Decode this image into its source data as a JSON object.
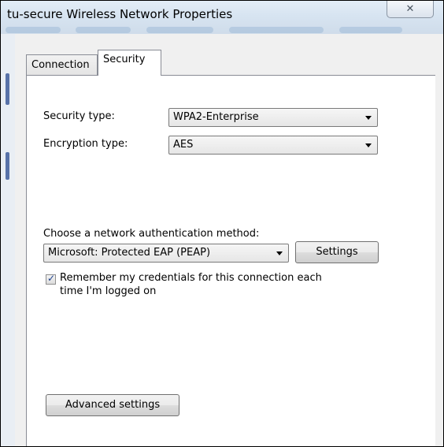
{
  "window": {
    "title": "tu-secure Wireless Network Properties",
    "close_glyph": "✕"
  },
  "tabs": [
    {
      "label": "Connection",
      "selected": false
    },
    {
      "label": "Security",
      "selected": true
    }
  ],
  "security": {
    "security_type_label": "Security type:",
    "security_type_value": "WPA2-Enterprise",
    "encryption_type_label": "Encryption type:",
    "encryption_type_value": "AES",
    "auth_method_label": "Choose a network authentication method:",
    "auth_method_value": "Microsoft: Protected EAP (PEAP)",
    "settings_button": "Settings",
    "remember_checked": true,
    "remember_label_line1": "Remember my credentials for this connection each",
    "remember_label_line2": "time I'm logged on",
    "advanced_button": "Advanced settings"
  },
  "icons": {
    "close": "close-icon",
    "dropdown": "chevron-down-icon",
    "check": "checkmark-icon"
  },
  "colors": {
    "title_bar": "#d7e4f1",
    "tab_panel_bg": "#ffffff",
    "window_bg": "#f0f0f0",
    "check_color": "#1a3e8c"
  }
}
